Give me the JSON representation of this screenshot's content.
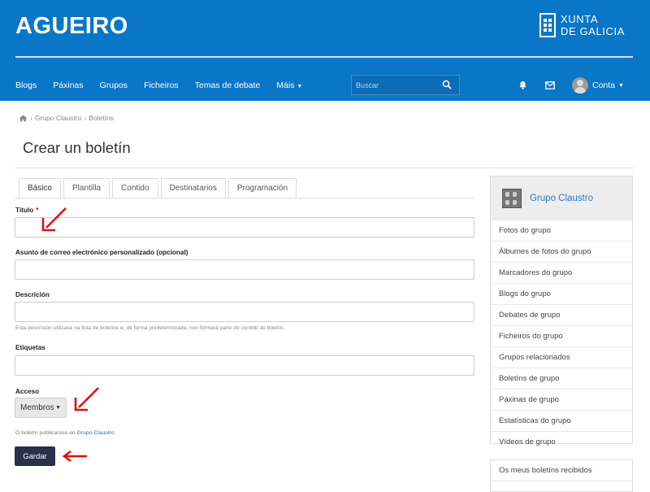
{
  "header": {
    "site_title": "AGUEIRO",
    "brand_line1": "XUNTA",
    "brand_line2": "DE GALICIA",
    "brand_color": "#0a76c8"
  },
  "nav": {
    "items": [
      "Blogs",
      "Páxinas",
      "Grupos",
      "Ficheiros",
      "Temas de debate",
      "Máis"
    ],
    "search_placeholder": "Buscar",
    "account_label": "Conta",
    "icons": [
      "search-icon",
      "bell-icon",
      "mail-icon",
      "chevron-down-icon"
    ]
  },
  "breadcrumb": {
    "home_icon": "home-icon",
    "items": [
      "Grupo Claustro",
      "Boletíns"
    ]
  },
  "page": {
    "title": "Crear un boletín"
  },
  "tabs": [
    "Básico",
    "Plantilla",
    "Contido",
    "Destinatarios",
    "Programación"
  ],
  "form": {
    "title_label": "Título",
    "title_required": "*",
    "subject_label": "Asunto de correo electrónico personalizado (opcional)",
    "description_label": "Descrición",
    "description_help": "Esta descrición utilizase na lista de boletíns e, de forma predeterminada, non formará parte do contido do boletín.",
    "tags_label": "Etiquetas",
    "access_label": "Acceso",
    "access_value": "Membros",
    "publish_note_prefix": "O boletín publicarase en",
    "publish_note_link": "Grupo Claustro",
    "save_label": "Gardar"
  },
  "sidebar": {
    "group_name": "Grupo Claustro",
    "items": [
      "Fotos do grupo",
      "Álbumes de fotos do grupo",
      "Marcadores do grupo",
      "Blogs do grupo",
      "Debates de grupo",
      "Ficheiros do grupo",
      "Grupos relacionados",
      "Boletíns de grupo",
      "Páxinas de grupo",
      "Estatísticas do grupo",
      "Vídeos de grupo"
    ],
    "secondary_items": [
      "Os meus boletíns recibidos"
    ]
  },
  "annotations": {
    "arrow_color": "#e01010"
  }
}
